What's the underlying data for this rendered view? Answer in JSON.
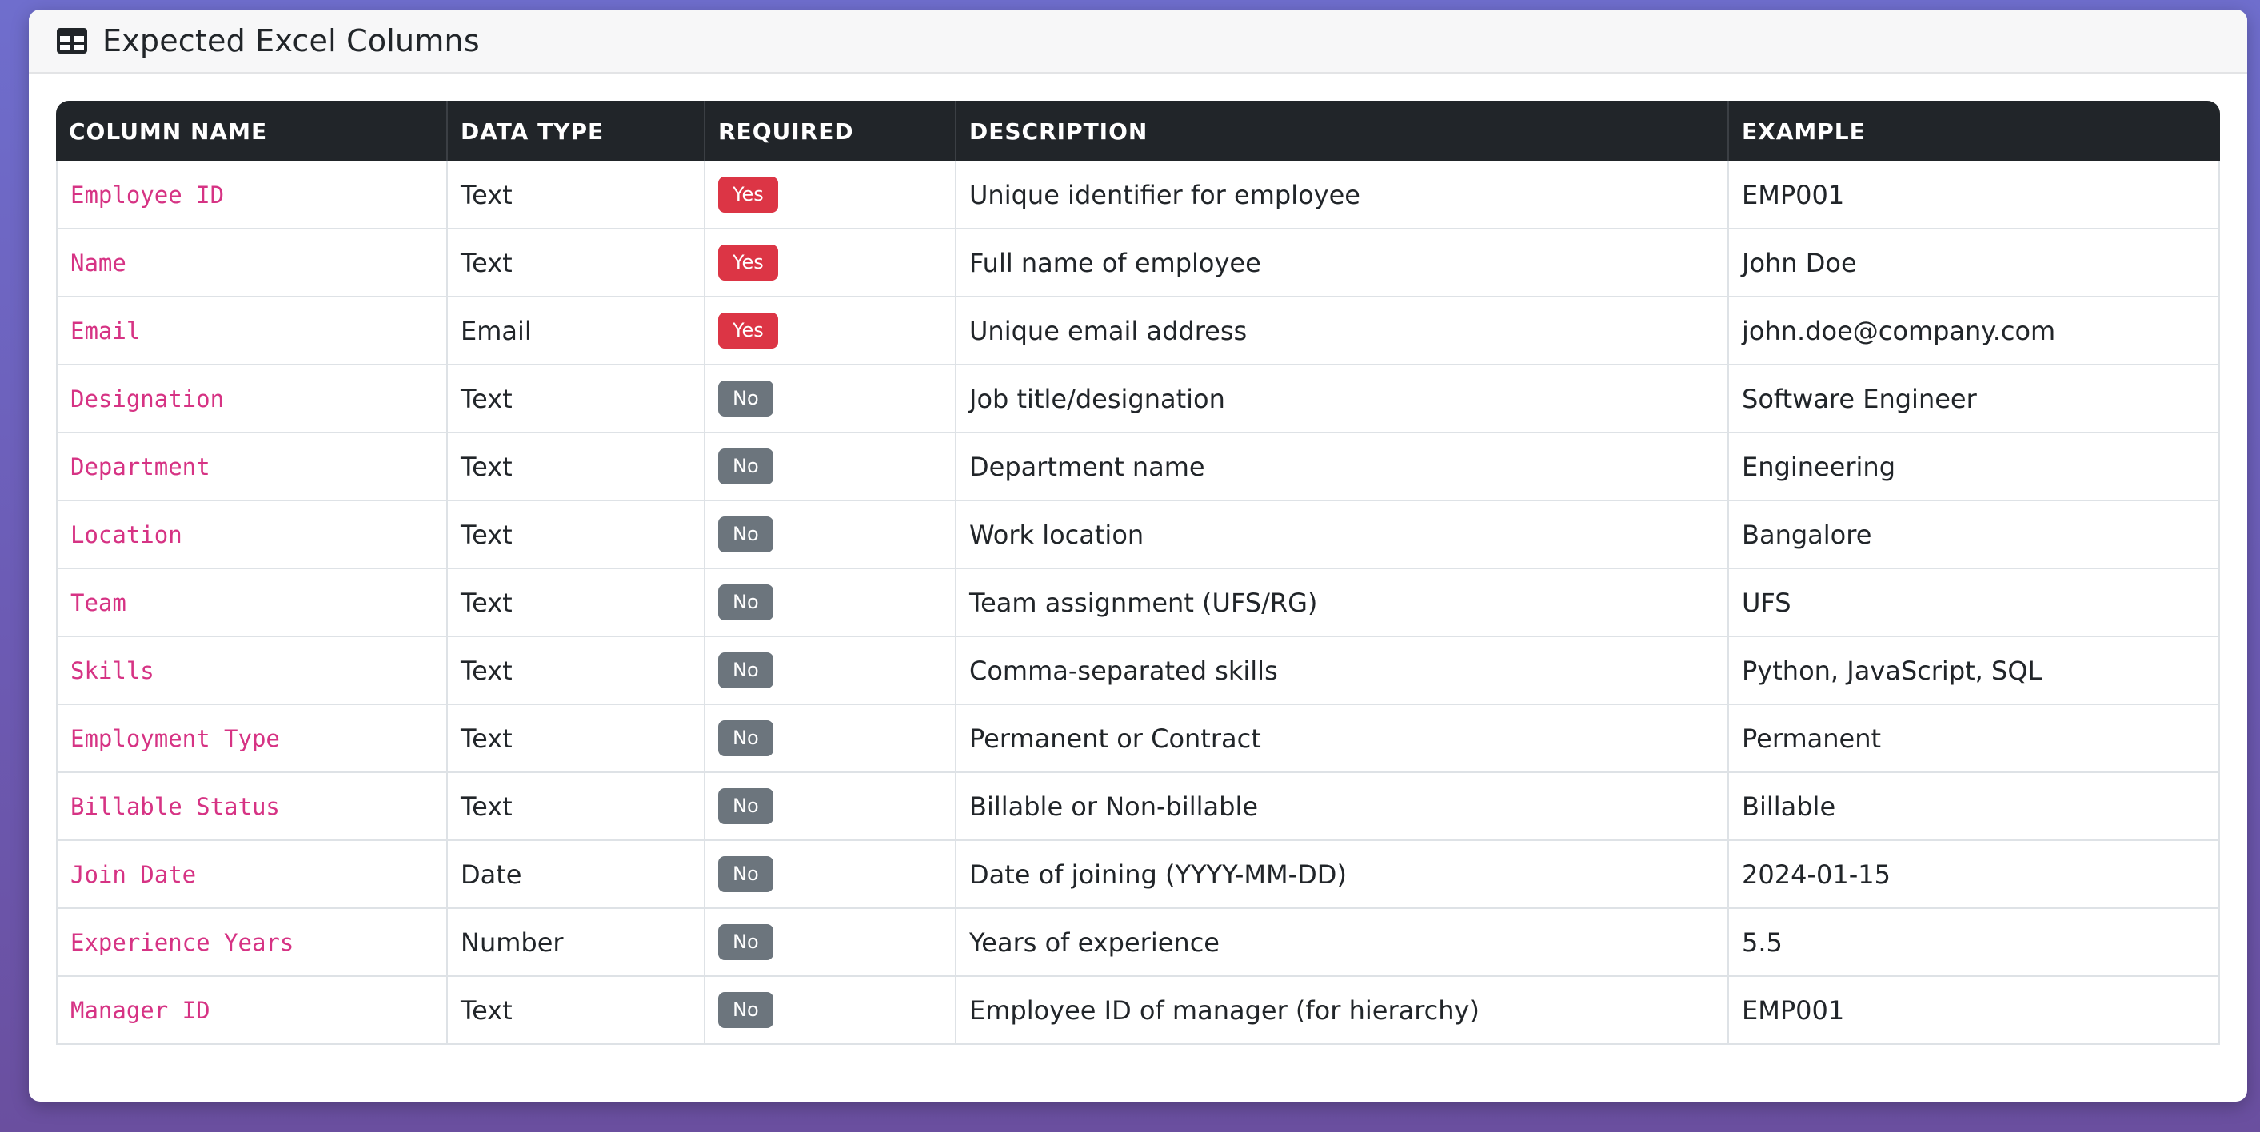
{
  "card": {
    "title": "Expected Excel Columns",
    "icon": "table-icon"
  },
  "table": {
    "headers": [
      "COLUMN NAME",
      "DATA TYPE",
      "REQUIRED",
      "DESCRIPTION",
      "EXAMPLE"
    ],
    "rows": [
      {
        "name": "Employee ID",
        "type": "Text",
        "required": "Yes",
        "description": "Unique identifier for employee",
        "example": "EMP001"
      },
      {
        "name": "Name",
        "type": "Text",
        "required": "Yes",
        "description": "Full name of employee",
        "example": "John Doe"
      },
      {
        "name": "Email",
        "type": "Email",
        "required": "Yes",
        "description": "Unique email address",
        "example": "john.doe@company.com"
      },
      {
        "name": "Designation",
        "type": "Text",
        "required": "No",
        "description": "Job title/designation",
        "example": "Software Engineer"
      },
      {
        "name": "Department",
        "type": "Text",
        "required": "No",
        "description": "Department name",
        "example": "Engineering"
      },
      {
        "name": "Location",
        "type": "Text",
        "required": "No",
        "description": "Work location",
        "example": "Bangalore"
      },
      {
        "name": "Team",
        "type": "Text",
        "required": "No",
        "description": "Team assignment (UFS/RG)",
        "example": "UFS"
      },
      {
        "name": "Skills",
        "type": "Text",
        "required": "No",
        "description": "Comma-separated skills",
        "example": "Python, JavaScript, SQL"
      },
      {
        "name": "Employment Type",
        "type": "Text",
        "required": "No",
        "description": "Permanent or Contract",
        "example": "Permanent"
      },
      {
        "name": "Billable Status",
        "type": "Text",
        "required": "No",
        "description": "Billable or Non-billable",
        "example": "Billable"
      },
      {
        "name": "Join Date",
        "type": "Date",
        "required": "No",
        "description": "Date of joining (YYYY-MM-DD)",
        "example": "2024-01-15"
      },
      {
        "name": "Experience Years",
        "type": "Number",
        "required": "No",
        "description": "Years of experience",
        "example": "5.5"
      },
      {
        "name": "Manager ID",
        "type": "Text",
        "required": "No",
        "description": "Employee ID of manager (for hierarchy)",
        "example": "EMP001"
      }
    ]
  },
  "colors": {
    "background_gradient": "#6f6ecd",
    "header_dark": "#212529",
    "column_name_text": "#d63384",
    "badge_required": "#dc3545",
    "badge_optional": "#6c757d"
  }
}
